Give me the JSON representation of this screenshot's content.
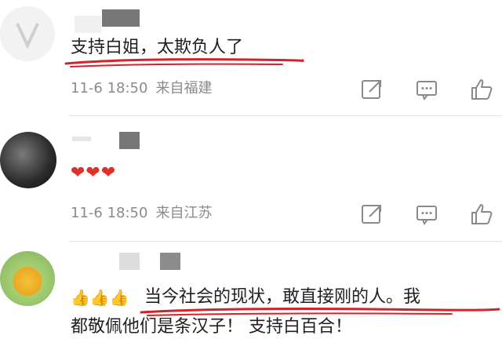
{
  "comments": [
    {
      "text": "支持白姐，太欺负人了",
      "time": "11-6 18:50",
      "source": "来自福建"
    },
    {
      "emoji": "❤❤❤",
      "time": "11-6 18:50",
      "source": "来自江苏"
    },
    {
      "thumbs": "👍👍👍",
      "text_line1": "当今社会的现状，敢直接刚的人。我",
      "text_line2": "都敬佩他们是条汉子！ 支持白百合！"
    }
  ],
  "icons": {
    "share": "share-icon",
    "comment": "comment-icon",
    "like": "thumbs-up-icon"
  },
  "colors": {
    "underline": "#d2232a",
    "meta": "#8a8a8a",
    "heart": "#e0302b"
  }
}
